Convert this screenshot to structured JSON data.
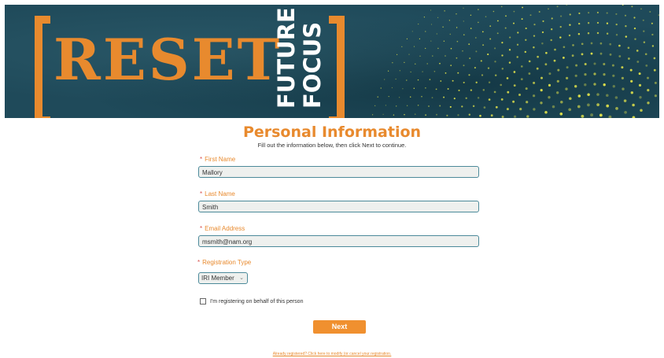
{
  "banner": {
    "logo_text": "RESET",
    "tagline_line1": "FUTURE",
    "tagline_line2": "FOCUS"
  },
  "form": {
    "title": "Personal Information",
    "subtitle": "Fill out the information below, then click Next to continue.",
    "required_marker": "*",
    "first_name": {
      "label": "First Name",
      "value": "Mallory"
    },
    "last_name": {
      "label": "Last Name",
      "value": "Smith"
    },
    "email": {
      "label": "Email Address",
      "value": "msmith@nam.org"
    },
    "registration_type": {
      "label": "Registration Type",
      "selected": "IRI Member"
    },
    "on_behalf_label": "I'm registering on behalf of this person",
    "next_label": "Next",
    "footer_link": "Already registered? Click here to modify (or cancel your registration."
  },
  "colors": {
    "accent": "#e88a2e",
    "banner_bg": "#1f4a5a",
    "dots": "#e8e84a"
  }
}
